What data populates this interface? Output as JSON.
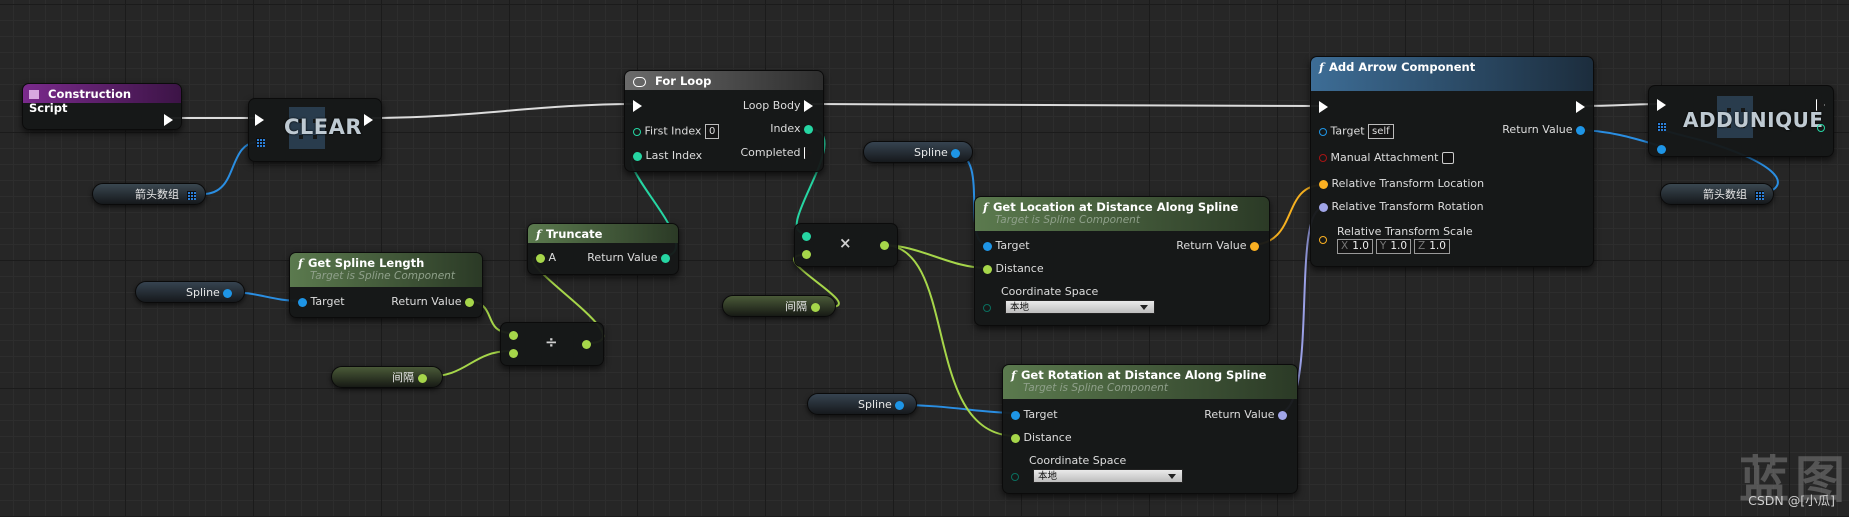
{
  "colors": {
    "exec": "#ffffff",
    "object": "#1e95e6",
    "float": "#8ae23d",
    "int": "#20dba0",
    "vector": "#fab022",
    "rotator": "#a0a5e8",
    "bool": "#8c1313",
    "construction_header": "#6a1b7a",
    "function_header": "#4a6640",
    "addarrow_header": "#2d4f6d"
  },
  "construction_script": {
    "title": "Construction Script"
  },
  "clear_node": {
    "title": "CLEAR"
  },
  "arrows_var_1": {
    "label": "箭头数组"
  },
  "arrows_var_2": {
    "label": "箭头数组"
  },
  "for_loop": {
    "title": "For Loop",
    "first_index": "First Index",
    "first_index_value": "0",
    "last_index": "Last Index",
    "loop_body": "Loop Body",
    "index": "Index",
    "completed": "Completed"
  },
  "get_spline_length": {
    "title": "Get Spline Length",
    "subtitle": "Target is Spline Component",
    "target": "Target",
    "return_value": "Return Value"
  },
  "spline_var_1": {
    "label": "Spline"
  },
  "spline_var_2": {
    "label": "Spline"
  },
  "spline_var_3": {
    "label": "Spline"
  },
  "interval_var_1": {
    "label": "间隔"
  },
  "interval_var_2": {
    "label": "间隔"
  },
  "truncate": {
    "title": "Truncate",
    "a": "A",
    "return_value": "Return Value"
  },
  "divide": {
    "symbol": "÷"
  },
  "multiply": {
    "symbol": "×"
  },
  "get_location": {
    "title": "Get Location at Distance Along Spline",
    "subtitle": "Target is Spline Component",
    "target": "Target",
    "distance": "Distance",
    "coordinate_space": "Coordinate Space",
    "coordinate_value": "本地",
    "return_value": "Return Value"
  },
  "get_rotation": {
    "title": "Get Rotation at Distance Along Spline",
    "subtitle": "Target is Spline Component",
    "target": "Target",
    "distance": "Distance",
    "coordinate_space": "Coordinate Space",
    "coordinate_value": "本地",
    "return_value": "Return Value"
  },
  "add_arrow": {
    "title": "Add Arrow Component",
    "target": "Target",
    "target_value": "self",
    "manual_attachment": "Manual Attachment",
    "rel_location": "Relative Transform Location",
    "rel_rotation": "Relative Transform Rotation",
    "rel_scale": "Relative Transform Scale",
    "scale_x_label": "X",
    "scale_x": "1.0",
    "scale_y_label": "Y",
    "scale_y": "1.0",
    "scale_z_label": "Z",
    "scale_z": "1.0",
    "return_value": "Return Value"
  },
  "add_unique": {
    "title": "ADDUNIQUE"
  },
  "watermark": {
    "text": "蓝图",
    "csdn": "CSDN @[小瓜]"
  }
}
